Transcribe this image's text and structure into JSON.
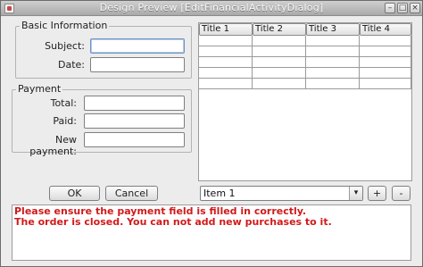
{
  "window": {
    "title": "Design Preview [EditFinancialActivityDialog]",
    "controls": {
      "minimize": "–",
      "maximize": "□",
      "close": "×"
    }
  },
  "basic_info": {
    "legend": "Basic Information",
    "subject_label": "Subject:",
    "subject_value": "",
    "date_label": "Date:",
    "date_value": ""
  },
  "payment": {
    "legend": "Payment",
    "total_label": "Total:",
    "total_value": "",
    "paid_label": "Paid:",
    "paid_value": "",
    "new_payment_label": "New payment:",
    "new_payment_value": ""
  },
  "table": {
    "columns": [
      "Title 1",
      "Title 2",
      "Title 3",
      "Title 4"
    ],
    "rows": [
      [
        "",
        "",
        "",
        ""
      ],
      [
        "",
        "",
        "",
        ""
      ],
      [
        "",
        "",
        "",
        ""
      ],
      [
        "",
        "",
        "",
        ""
      ],
      [
        "",
        "",
        "",
        ""
      ]
    ]
  },
  "buttons": {
    "ok": "OK",
    "cancel": "Cancel",
    "add": "+",
    "remove": "-"
  },
  "items_combo": {
    "selected": "Item 1",
    "arrow": "▾"
  },
  "messages": [
    "Please ensure the payment field is filled in correctly.",
    "The order is closed. You can not add new purchases to it."
  ],
  "colors": {
    "error_text": "#d11a1a",
    "focus_border": "#6f91c4"
  }
}
